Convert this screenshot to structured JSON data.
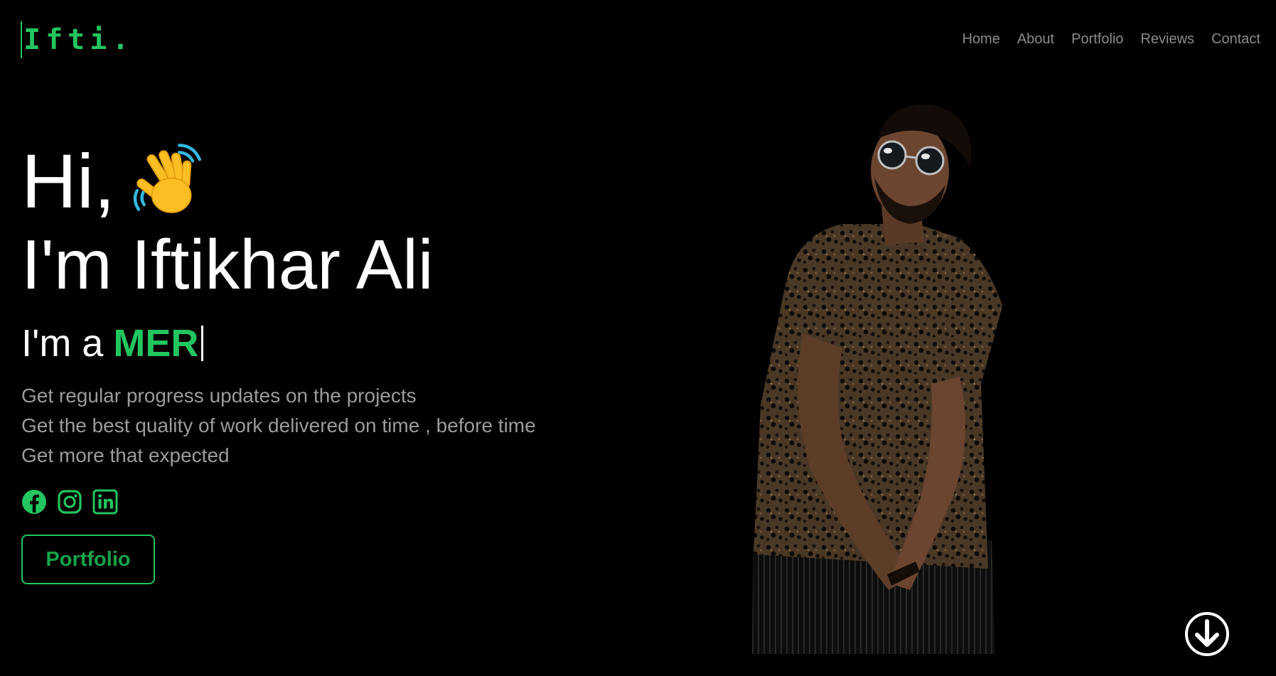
{
  "brand": {
    "logo_text": "Ifti."
  },
  "nav": {
    "items": [
      {
        "label": "Home"
      },
      {
        "label": "About"
      },
      {
        "label": "Portfolio"
      },
      {
        "label": "Reviews"
      },
      {
        "label": "Contact"
      }
    ]
  },
  "hero": {
    "greeting": "Hi,",
    "greeting_icon": "waving-hand-emoji",
    "name": "I'm Iftikhar Ali",
    "role_prefix": "I'm a",
    "role_typed": "MER",
    "taglines": [
      "Get regular progress updates on the projects",
      "Get the best quality of work delivered on time , before time",
      "Get more that expected"
    ],
    "socials": [
      {
        "icon": "facebook-icon"
      },
      {
        "icon": "instagram-icon"
      },
      {
        "icon": "linkedin-icon"
      }
    ],
    "cta_label": "Portfolio",
    "scroll_icon": "arrow-down-circle-icon"
  },
  "colors": {
    "accent": "#22c55e",
    "background": "#000000",
    "muted_text": "#9b9b9b",
    "nav_text": "#8a8a8a"
  }
}
